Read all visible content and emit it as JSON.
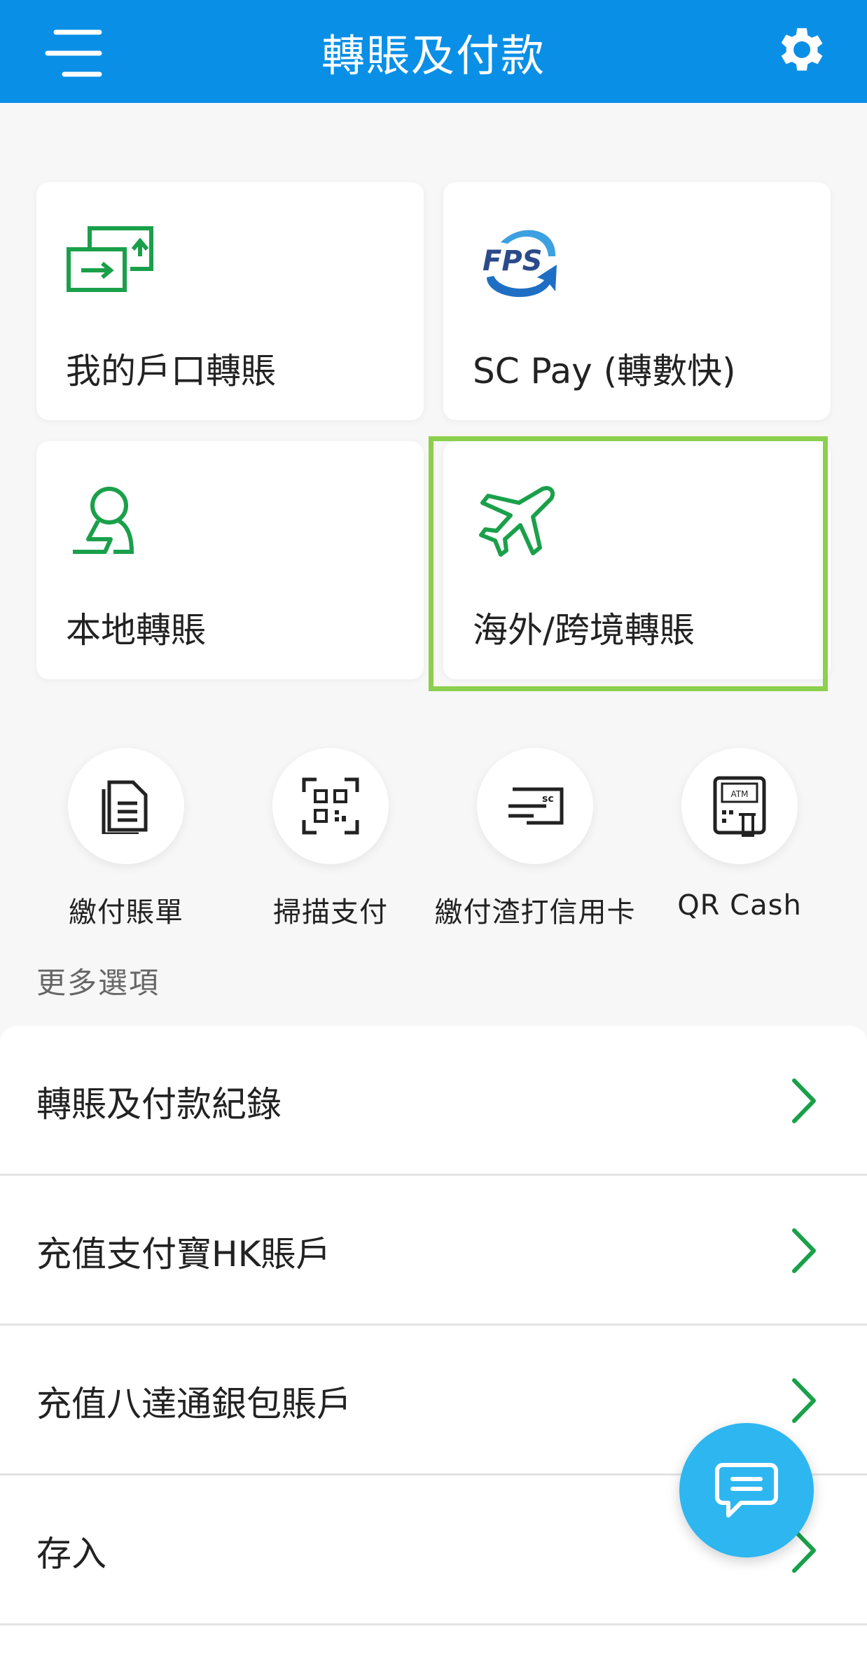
{
  "header": {
    "title": "轉賬及付款"
  },
  "tiles": [
    {
      "label": "我的戶口轉賬",
      "icon": "transfer-arrows-icon"
    },
    {
      "label": "SC Pay (轉數快)",
      "icon": "fps-logo-icon",
      "logo_text": "FPS"
    },
    {
      "label": "本地轉賬",
      "icon": "person-transfer-icon"
    },
    {
      "label": "海外/跨境轉賬",
      "icon": "airplane-icon"
    }
  ],
  "quick_actions": [
    {
      "label": "繳付賬單",
      "icon": "bill-document-icon"
    },
    {
      "label": "掃描支付",
      "icon": "qr-scan-icon"
    },
    {
      "label": "繳付渣打信用卡",
      "icon": "credit-card-icon",
      "card_text": "sc"
    },
    {
      "label": "QR Cash",
      "icon": "atm-icon",
      "atm_text": "ATM"
    }
  ],
  "more": {
    "title": "更多選項",
    "items": [
      {
        "label": "轉賬及付款紀錄"
      },
      {
        "label": "充值支付寶HK賬戶"
      },
      {
        "label": "充值八達通銀包賬戶"
      },
      {
        "label": "存入"
      }
    ]
  },
  "colors": {
    "header": "#0a8fe6",
    "accent_green": "#1aa04a",
    "highlight": "#8ccf4d",
    "chat": "#2eb6f0"
  }
}
